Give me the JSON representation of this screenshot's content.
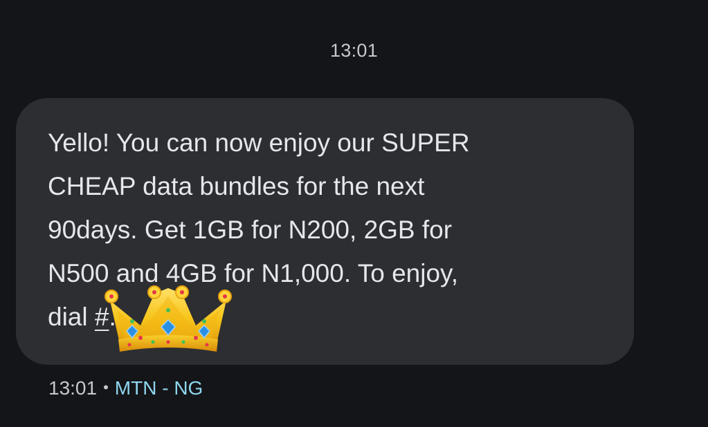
{
  "header": {
    "time": "13:01"
  },
  "message": {
    "text": "Yello! You can now enjoy our SUPER\nCHEAP data bundles for the next\n90days. Get 1GB for N200, 2GB for\nN500 and 4GB for N1,000. To enjoy,\ndial ",
    "code_suffix": "#",
    "end": ".",
    "timestamp": "13:01",
    "separator": "•",
    "sender": "MTN - NG"
  },
  "colors": {
    "background": "#141518",
    "bubble": "#2d2e31",
    "text": "#e6e7ea",
    "sender_accent": "#8fd6ef"
  },
  "icons": {
    "overlay": "crown-icon"
  }
}
